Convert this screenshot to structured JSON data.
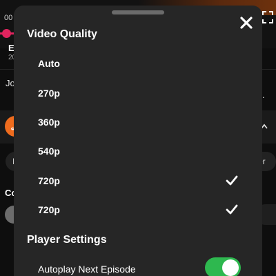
{
  "background": {
    "time_text": "00",
    "episode_title_initial": "E",
    "episode_sub": "20",
    "desc_text": "Jo co",
    "desc_tail": ".",
    "avatar_glyph": "ʆ",
    "pill_left_text": "I",
    "pill_right_text": "er",
    "comments_initial": "Co"
  },
  "sheet": {
    "video_quality_title": "Video Quality",
    "quality_options": [
      {
        "label": "Auto",
        "selected": false
      },
      {
        "label": "270p",
        "selected": false
      },
      {
        "label": "360p",
        "selected": false
      },
      {
        "label": "540p",
        "selected": false
      },
      {
        "label": "720p",
        "selected": true
      },
      {
        "label": "720p",
        "selected": true
      }
    ],
    "player_settings_title": "Player Settings",
    "autoplay_label": "Autoplay Next Episode",
    "autoplay_enabled": true
  },
  "colors": {
    "sheet_bg": "#262626",
    "toggle_on": "#2eb84f",
    "progress_accent": "#e0245e",
    "avatar_orange": "#ef6c1e"
  }
}
